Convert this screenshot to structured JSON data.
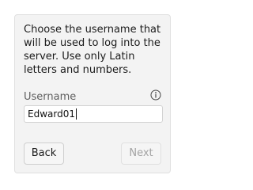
{
  "dialog": {
    "instructions": "Choose the username that will be used to log into the server. Use only Latin letters and numbers.",
    "field_label": "Username",
    "username_value": "Edward01",
    "back_label": "Back",
    "next_label": "Next",
    "next_enabled": false,
    "info_icon": "info-icon"
  }
}
